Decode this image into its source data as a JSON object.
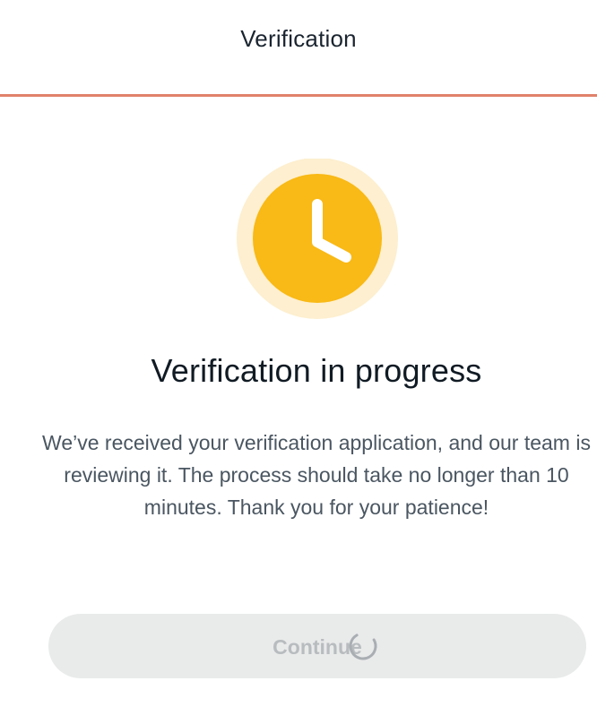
{
  "header": {
    "title": "Verification"
  },
  "status": {
    "icon": "clock-icon",
    "title": "Verification in progress",
    "message": "We’ve received your verification application, and our team is reviewing it. The process should take no longer than 10 minutes. Thank you for your patience!"
  },
  "actions": {
    "continue_label": "Continue",
    "continue_loading_icon": "spinner-icon",
    "continue_state": "disabled-loading"
  },
  "colors": {
    "accent_line": "#e0816a",
    "clock_fill": "#f9b916",
    "clock_halo": "#fdefcf",
    "button_bg": "#e9eaea",
    "button_text": "#b8bcbf"
  }
}
